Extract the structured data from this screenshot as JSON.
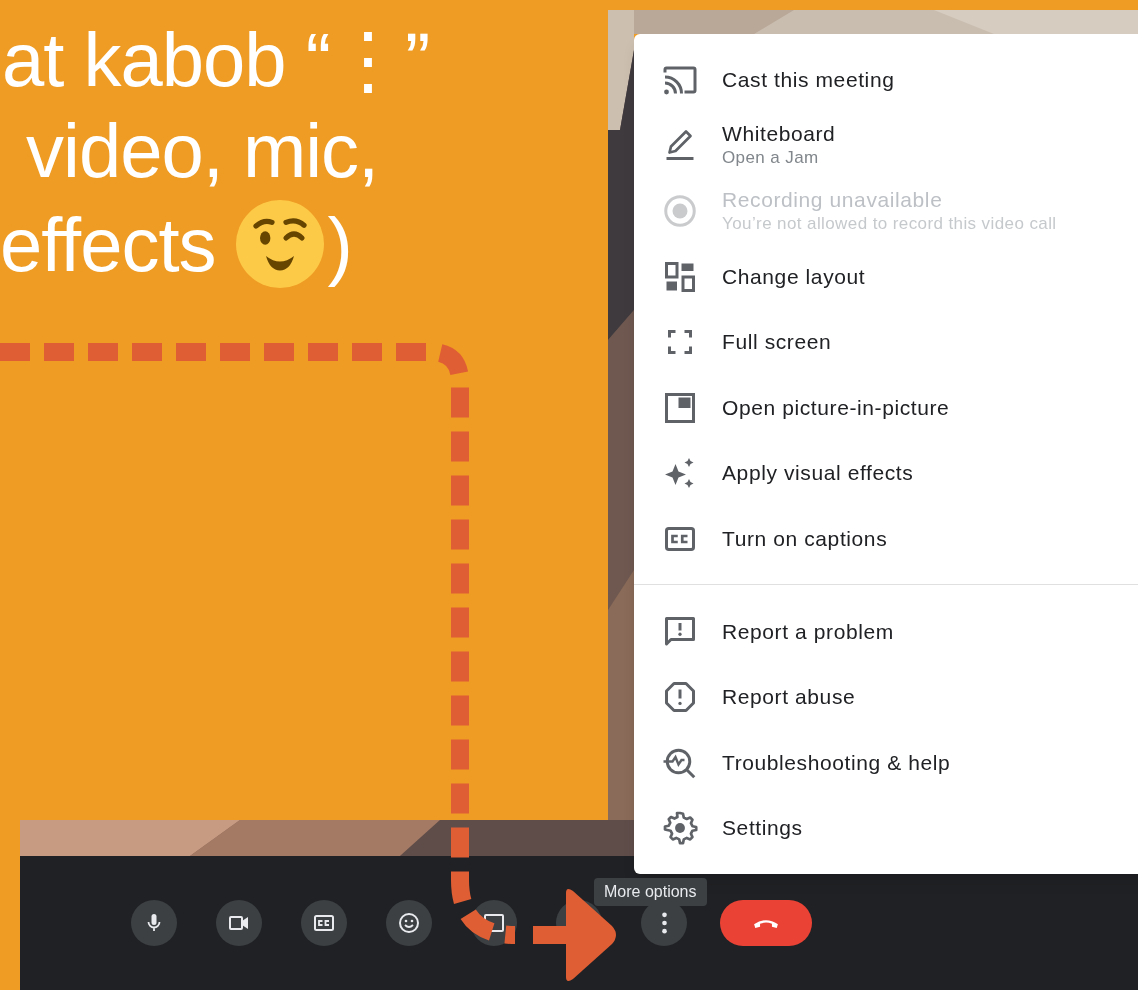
{
  "heading": {
    "lines": [
      "at kabob “⋮”",
      "video, mic,",
      "effects"
    ],
    "closing": ")"
  },
  "menu": {
    "sections": [
      {
        "items": [
          {
            "label": "Cast this meeting",
            "disabled": false
          },
          {
            "label": "Whiteboard",
            "sublabel": "Open a Jam",
            "disabled": false
          },
          {
            "label": "Recording unavailable",
            "sublabel": "You’re not allowed to record this video call",
            "disabled": true
          },
          {
            "label": "Change layout",
            "disabled": false
          },
          {
            "label": "Full screen",
            "disabled": false
          },
          {
            "label": "Open picture-in-picture",
            "disabled": false
          },
          {
            "label": "Apply visual effects",
            "disabled": false
          },
          {
            "label": "Turn on captions",
            "disabled": false
          }
        ]
      },
      {
        "items": [
          {
            "label": "Report a problem",
            "disabled": false
          },
          {
            "label": "Report abuse",
            "disabled": false
          },
          {
            "label": "Troubleshooting & help",
            "disabled": false
          },
          {
            "label": "Settings",
            "disabled": false
          }
        ]
      }
    ]
  },
  "tooltip": "More options",
  "toolbar": {
    "buttons": [
      {
        "kind": "control"
      },
      {
        "kind": "control"
      },
      {
        "kind": "control"
      },
      {
        "kind": "control"
      },
      {
        "kind": "control"
      },
      {
        "kind": "control"
      },
      {
        "kind": "control"
      },
      {
        "kind": "hangup"
      }
    ]
  }
}
